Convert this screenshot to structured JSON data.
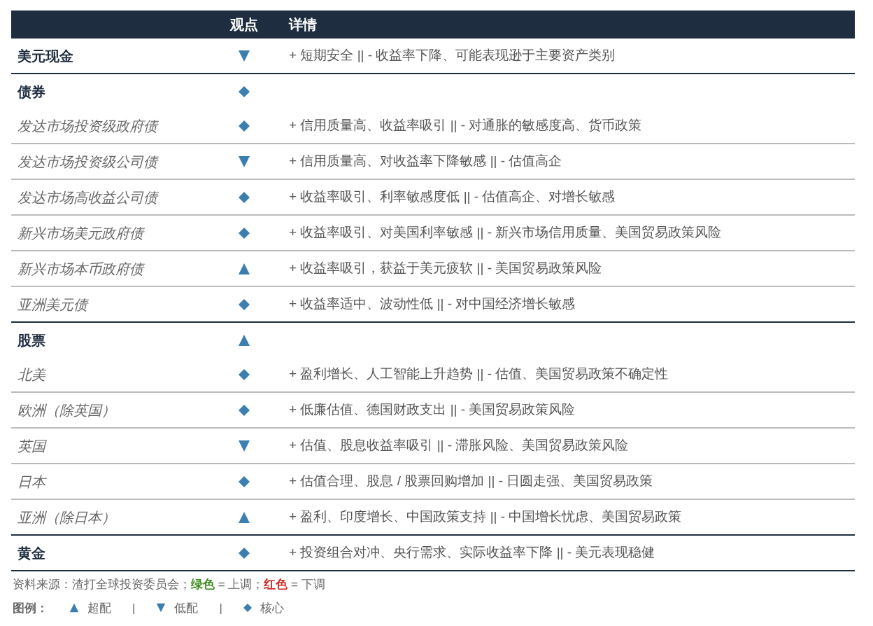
{
  "table": {
    "columns": [
      "观点",
      "详情"
    ],
    "sections": [
      {
        "name": "美元现金",
        "kind": "down",
        "detail": "+ 短期安全 || - 收益率下降、可能表现逊于主要资产类别"
      },
      {
        "name": "债券",
        "kind": "core",
        "items": [
          {
            "name": "发达市场投资级政府债",
            "kind": "core",
            "detail": "+ 信用质量高、收益率吸引 || - 对通胀的敏感度高、货币政策"
          },
          {
            "name": "发达市场投资级公司债",
            "kind": "down",
            "detail": "+ 信用质量高、对收益率下降敏感 || - 估值高企"
          },
          {
            "name": "发达市场高收益公司债",
            "kind": "core",
            "detail": "+ 收益率吸引、利率敏感度低 || - 估值高企、对增长敏感"
          },
          {
            "name": "新兴市场美元政府债",
            "kind": "core",
            "detail": "+ 收益率吸引、对美国利率敏感 || - 新兴市场信用质量、美国贸易政策风险"
          },
          {
            "name": "新兴市场本币政府债",
            "kind": "up",
            "detail": "+ 收益率吸引，获益于美元疲软 || - 美国贸易政策风险"
          },
          {
            "name": "亚洲美元债",
            "kind": "core",
            "detail": "+ 收益率适中、波动性低 || - 对中国经济增长敏感"
          }
        ]
      },
      {
        "name": "股票",
        "kind": "up",
        "items": [
          {
            "name": "北美",
            "kind": "core",
            "detail": "+ 盈利增长、人工智能上升趋势 || - 估值、美国贸易政策不确定性"
          },
          {
            "name": "欧洲（除英国）",
            "kind": "core",
            "detail": "+ 低廉估值、德国财政支出 || - 美国贸易政策风险"
          },
          {
            "name": "英国",
            "kind": "down",
            "detail": "+ 估值、股息收益率吸引 || - 滞胀风险、美国贸易政策风险"
          },
          {
            "name": "日本",
            "kind": "core",
            "detail": "+ 估值合理、股息 / 股票回购增加 || - 日圆走强、美国贸易政策"
          },
          {
            "name": "亚洲（除日本）",
            "kind": "up",
            "detail": "+ 盈利、印度增长、中国政策支持 || - 中国增长忧虑、美国贸易政策"
          }
        ]
      },
      {
        "name": "黄金",
        "kind": "core",
        "detail": "+ 投资组合对冲、央行需求、实际收益率下降 || - 美元表现稳健"
      }
    ]
  },
  "source_note": [
    {
      "kind": "plain",
      "text": "资料来源：渣打全球投资委员会；"
    },
    {
      "kind": "green",
      "text": "绿色"
    },
    {
      "kind": "plain",
      "text": " = 上调；"
    },
    {
      "kind": "red",
      "text": "红色"
    },
    {
      "kind": "plain",
      "text": " = 下调"
    }
  ],
  "legend": {
    "label": "图例：",
    "items": [
      {
        "kind": "up",
        "label": "超配"
      },
      {
        "kind": "separator",
        "label": "|"
      },
      {
        "kind": "down",
        "label": "低配"
      },
      {
        "kind": "separator",
        "label": "|"
      },
      {
        "kind": "core",
        "label": "核心"
      }
    ]
  }
}
